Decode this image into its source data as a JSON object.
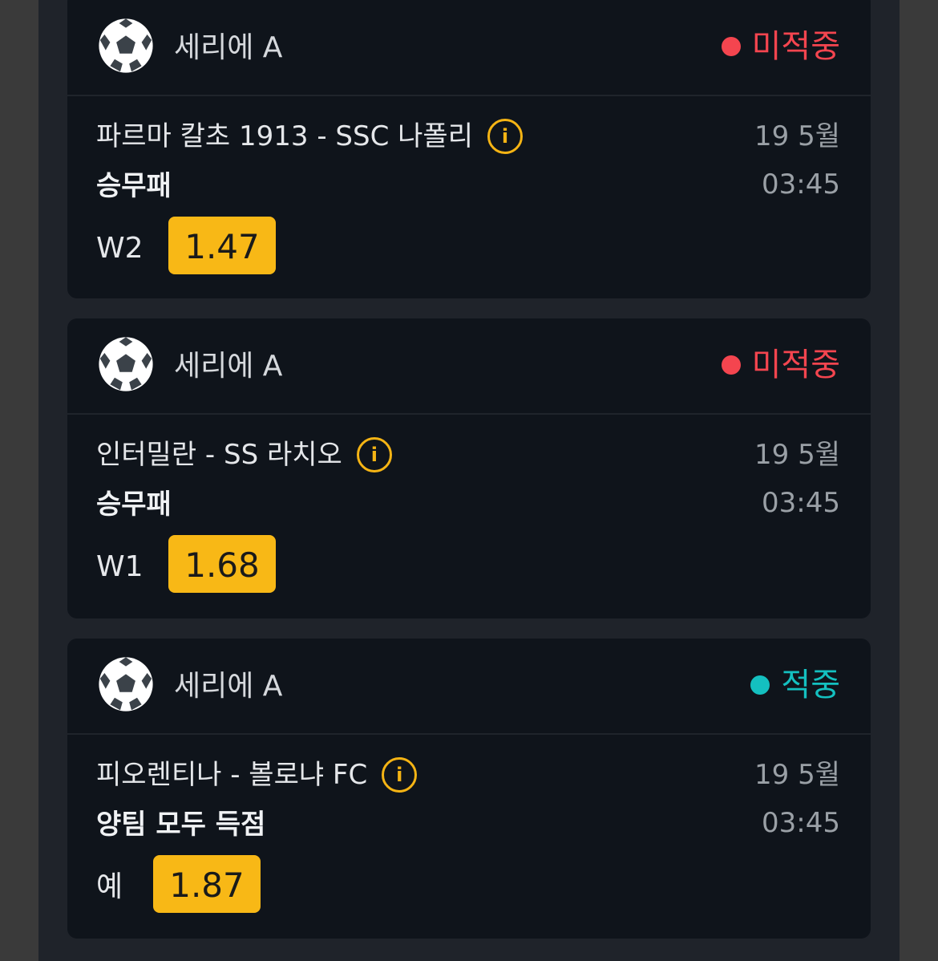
{
  "colors": {
    "lost": "#f4454f",
    "won": "#14c0c0",
    "odds_bg": "#f8b816",
    "info": "#f5b414"
  },
  "bets": [
    {
      "league": "세리에 A",
      "league_icon": "soccer-ball-icon",
      "status": "미적중",
      "status_color": "#f4454f",
      "match": "파르마 칼초 1913 - SSC 나폴리",
      "market": "승무패",
      "pick": "W2",
      "odds": "1.47",
      "date": "19 5월",
      "time": "03:45"
    },
    {
      "league": "세리에 A",
      "league_icon": "soccer-ball-icon",
      "status": "미적중",
      "status_color": "#f4454f",
      "match": "인터밀란 - SS 라치오",
      "market": "승무패",
      "pick": "W1",
      "odds": "1.68",
      "date": "19 5월",
      "time": "03:45"
    },
    {
      "league": "세리에 A",
      "league_icon": "soccer-ball-icon",
      "status": "적중",
      "status_color": "#14c0c0",
      "match": "피오렌티나 - 볼로냐 FC",
      "market": "양팀 모두 득점",
      "pick": "예",
      "odds": "1.87",
      "date": "19 5월",
      "time": "03:45"
    }
  ]
}
